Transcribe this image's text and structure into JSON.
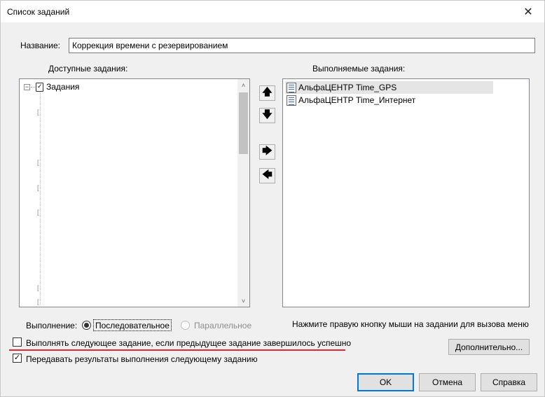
{
  "window": {
    "title": "Список заданий",
    "close_glyph": "✕"
  },
  "name_field": {
    "label": "Название:",
    "value": "Коррекция времени с резервированием"
  },
  "available": {
    "header": "Доступные задания:",
    "root_label": "Задания",
    "scroll_up": "˄",
    "scroll_down": "˅"
  },
  "executed": {
    "header": "Выполняемые задания:",
    "items": [
      {
        "label": "АльфаЦЕНТР Time_GPS"
      },
      {
        "label": "АльфаЦЕНТР Time_Интернет"
      }
    ]
  },
  "move_buttons": {
    "up": "🡅",
    "down": "🡇",
    "right": "🡆",
    "left": "🡄"
  },
  "execution": {
    "label": "Выполнение:",
    "sequential": "Последовательное",
    "parallel": "Параллельное",
    "selected": "sequential"
  },
  "hint": "Нажмите правую кнопку мыши на задании для вызова меню",
  "options": {
    "run_next_if_success": {
      "label": "Выполнять следующее задание, если предыдущее задание завершилось успешно",
      "checked": false
    },
    "pass_results": {
      "label": "Передавать результаты выполнения следующему заданию",
      "checked": true
    }
  },
  "buttons": {
    "advanced": "Дополнительно...",
    "ok": "OK",
    "cancel": "Отмена",
    "help": "Справка"
  },
  "colors": {
    "accent": "#0078d7",
    "annotation_red": "#e0262e"
  }
}
